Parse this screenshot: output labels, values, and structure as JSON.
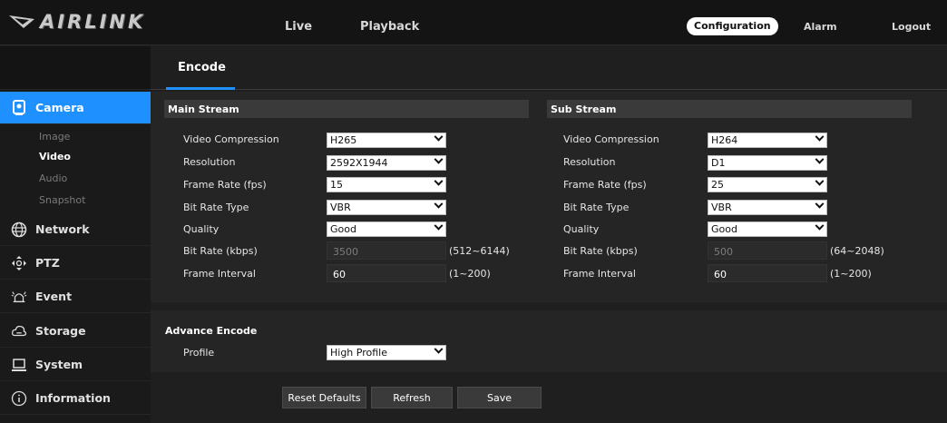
{
  "brand": {
    "name": "AIRLINK"
  },
  "topnav": {
    "live": "Live",
    "playback": "Playback",
    "configuration": "Configuration",
    "alarm": "Alarm",
    "logout": "Logout"
  },
  "sidebar": {
    "items": [
      {
        "label": "Camera",
        "icon": "camera-icon",
        "active": true
      },
      {
        "label": "Network",
        "icon": "network-globe-icon"
      },
      {
        "label": "PTZ",
        "icon": "ptz-arrows-icon"
      },
      {
        "label": "Event",
        "icon": "event-alarm-icon"
      },
      {
        "label": "Storage",
        "icon": "storage-cloud-icon"
      },
      {
        "label": "System",
        "icon": "system-laptop-icon"
      },
      {
        "label": "Information",
        "icon": "info-circle-icon"
      }
    ],
    "camera_sub": [
      {
        "label": "Image"
      },
      {
        "label": "Video",
        "active": true
      },
      {
        "label": "Audio"
      },
      {
        "label": "Snapshot"
      }
    ]
  },
  "tab": {
    "encode": "Encode"
  },
  "labels": {
    "video_compression": "Video Compression",
    "resolution": "Resolution",
    "frame_rate": "Frame Rate (fps)",
    "bit_rate_type": "Bit Rate Type",
    "quality": "Quality",
    "bit_rate": "Bit Rate (kbps)",
    "frame_interval": "Frame Interval"
  },
  "main_stream": {
    "title": "Main Stream",
    "video_compression": "H265",
    "resolution": "2592X1944",
    "frame_rate": "15",
    "bit_rate_type": "VBR",
    "quality": "Good",
    "bit_rate": "3500",
    "bit_rate_range": "(512~6144)",
    "frame_interval": "60",
    "frame_interval_range": "(1~200)"
  },
  "sub_stream": {
    "title": "Sub Stream",
    "video_compression": "H264",
    "resolution": "D1",
    "frame_rate": "25",
    "bit_rate_type": "VBR",
    "quality": "Good",
    "bit_rate": "500",
    "bit_rate_range": "(64~2048)",
    "frame_interval": "60",
    "frame_interval_range": "(1~200)"
  },
  "advance": {
    "title": "Advance Encode",
    "profile_label": "Profile",
    "profile": "High Profile"
  },
  "buttons": {
    "reset": "Reset Defaults",
    "refresh": "Refresh",
    "save": "Save"
  },
  "colors": {
    "accent": "#1e90ff",
    "background": "#1f1f1f",
    "topbar": "#141414"
  }
}
